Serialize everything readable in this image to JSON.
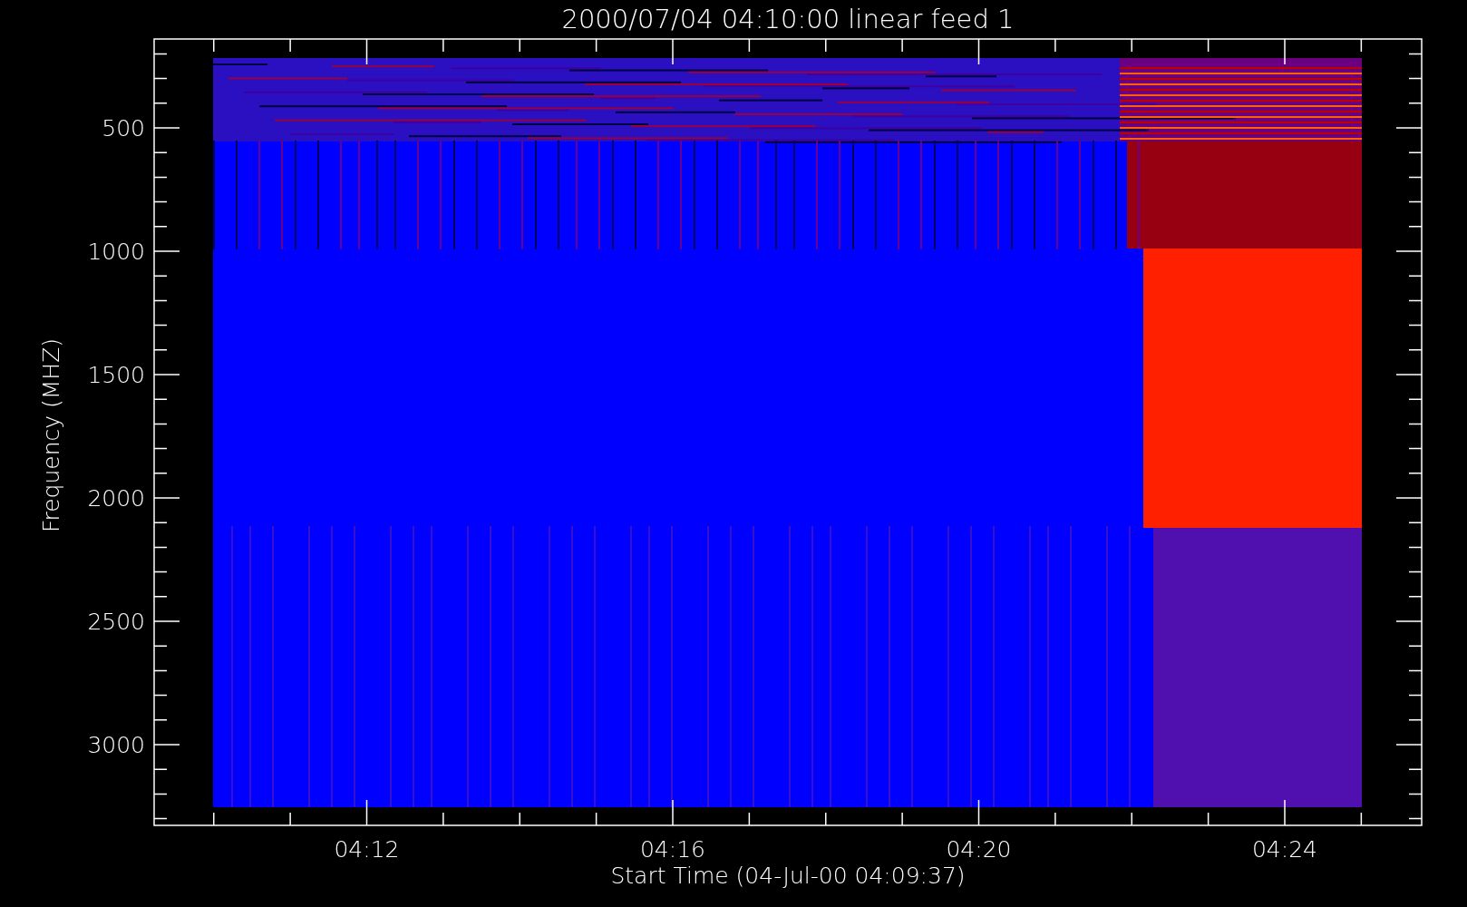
{
  "title": "2000/07/04 04:10:00 linear feed 1",
  "y_axis": {
    "label": "Frequency (MHZ)",
    "ticks": [
      "500",
      "1000",
      "1500",
      "2000",
      "2500",
      "3000"
    ]
  },
  "x_axis": {
    "label": "Start Time (04-Jul-00 04:09:37)",
    "ticks": [
      "04:12",
      "04:16",
      "04:20",
      "04:24"
    ]
  }
}
